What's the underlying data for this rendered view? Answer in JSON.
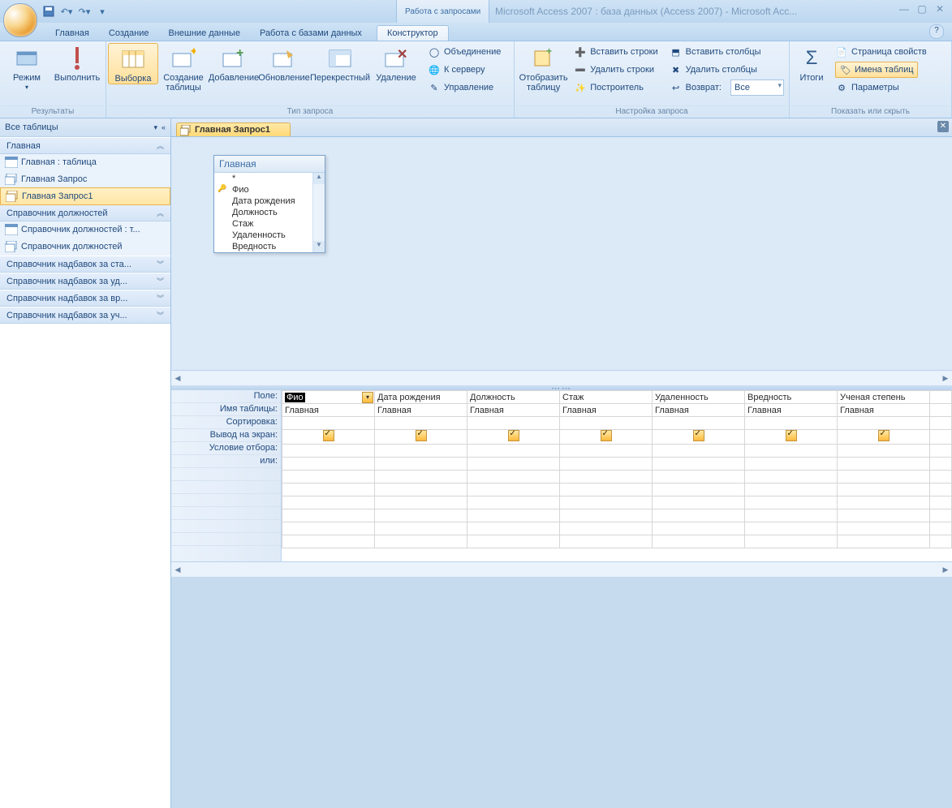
{
  "titlebar": {
    "contextual": "Работа с запросами",
    "app_title": "Microsoft Access 2007 : база данных (Access 2007) - Microsoft Acc..."
  },
  "tabs": {
    "t0": "Главная",
    "t1": "Создание",
    "t2": "Внешние данные",
    "t3": "Работа с базами данных",
    "t4": "Конструктор"
  },
  "ribbon": {
    "g_results": "Результаты",
    "g_type": "Тип запроса",
    "g_setup": "Настройка запроса",
    "g_show": "Показать или скрыть",
    "mode": "Режим",
    "run": "Выполнить",
    "select": "Выборка",
    "maketable": "Создание таблицы",
    "append": "Добавление",
    "update": "Обновление",
    "crosstab": "Перекрестный",
    "delete": "Удаление",
    "union": "Объединение",
    "server": "К серверу",
    "manage": "Управление",
    "showtable": "Отобразить таблицу",
    "insrows": "Вставить строки",
    "delrows": "Удалить строки",
    "builder": "Построитель",
    "inscols": "Вставить столбцы",
    "delcols": "Удалить столбцы",
    "return": "Возврат:",
    "return_val": "Все",
    "totals": "Итоги",
    "propsheet": "Страница свойств",
    "tablenames": "Имена таблиц",
    "params": "Параметры"
  },
  "nav": {
    "header": "Все таблицы",
    "grp_main": "Главная",
    "i_tbl": "Главная : таблица",
    "i_q0": "Главная Запрос",
    "i_q1": "Главная Запрос1",
    "grp_pos": "Справочник должностей",
    "i_pos_tbl": "Справочник должностей : т...",
    "i_pos": "Справочник должностей",
    "grp_sta": "Справочник надбавок за ста...",
    "grp_ud": "Справочник надбавок за уд...",
    "grp_vr": "Справочник надбавок за вр...",
    "grp_uch": "Справочник надбавок за уч..."
  },
  "doc": {
    "tab": "Главная Запрос1"
  },
  "table_box": {
    "title": "Главная",
    "fields": [
      "*",
      "Фио",
      "Дата рождения",
      "Должность",
      "Стаж",
      "Удаленность",
      "Вредность"
    ]
  },
  "grid": {
    "rows": {
      "field": "Поле:",
      "table": "Имя таблицы:",
      "sort": "Сортировка:",
      "show": "Вывод на экран:",
      "criteria": "Условие отбора:",
      "or": "или:"
    },
    "cols": [
      {
        "field": "Фио",
        "table": "Главная"
      },
      {
        "field": "Дата рождения",
        "table": "Главная"
      },
      {
        "field": "Должность",
        "table": "Главная"
      },
      {
        "field": "Стаж",
        "table": "Главная"
      },
      {
        "field": "Удаленность",
        "table": "Главная"
      },
      {
        "field": "Вредность",
        "table": "Главная"
      },
      {
        "field": "Ученая степень",
        "table": "Главная"
      }
    ]
  }
}
